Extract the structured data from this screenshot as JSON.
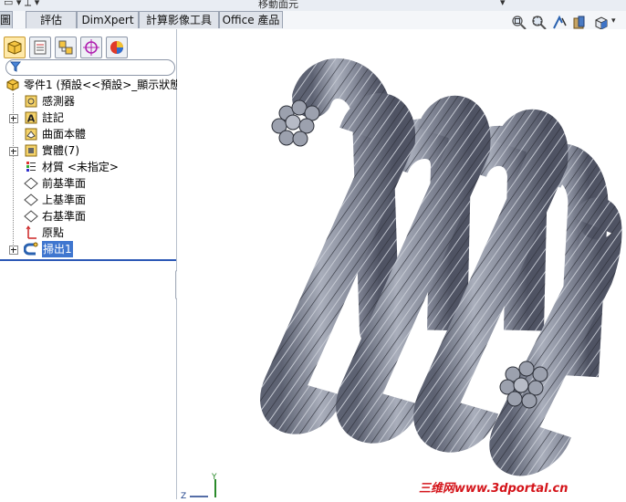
{
  "top_fragments": {
    "a": "移動面元"
  },
  "tabs": [
    {
      "label": "圖"
    },
    {
      "label": "評估"
    },
    {
      "label": "DimXpert"
    },
    {
      "label": "計算影像工具"
    },
    {
      "label": "Office 產品"
    }
  ],
  "view_tools": [
    "zoom-to-fit-icon",
    "zoom-area-icon",
    "previous-view-icon",
    "section-view-icon",
    "view-orientation-icon"
  ],
  "sidebar": {
    "manager_tabs": [
      "feature-manager-icon",
      "property-manager-icon",
      "configuration-manager-icon",
      "dimxpert-manager-icon",
      "display-manager-icon"
    ],
    "tree": {
      "root": "零件1 (預設<<預設>_顯示狀態",
      "items": [
        {
          "label": "感測器",
          "icon": "sensor-icon"
        },
        {
          "label": "註記",
          "icon": "annotation-icon"
        },
        {
          "label": "曲面本體",
          "icon": "surface-bodies-icon"
        },
        {
          "label": "實體(7)",
          "icon": "solid-bodies-icon"
        },
        {
          "label": "材質 <未指定>",
          "icon": "material-icon"
        },
        {
          "label": "前基準面",
          "icon": "plane-icon"
        },
        {
          "label": "上基準面",
          "icon": "plane-icon"
        },
        {
          "label": "右基準面",
          "icon": "plane-icon"
        },
        {
          "label": "原點",
          "icon": "origin-icon"
        },
        {
          "label": "掃出1",
          "icon": "sweep-icon"
        }
      ]
    }
  },
  "triad": {
    "y": "Y",
    "z": "Z"
  },
  "watermark": "三维网www.3dportal.cn",
  "colors": {
    "model": "#8a8f9e",
    "selection": "#3f76cf",
    "watermark": "#d4141a"
  }
}
